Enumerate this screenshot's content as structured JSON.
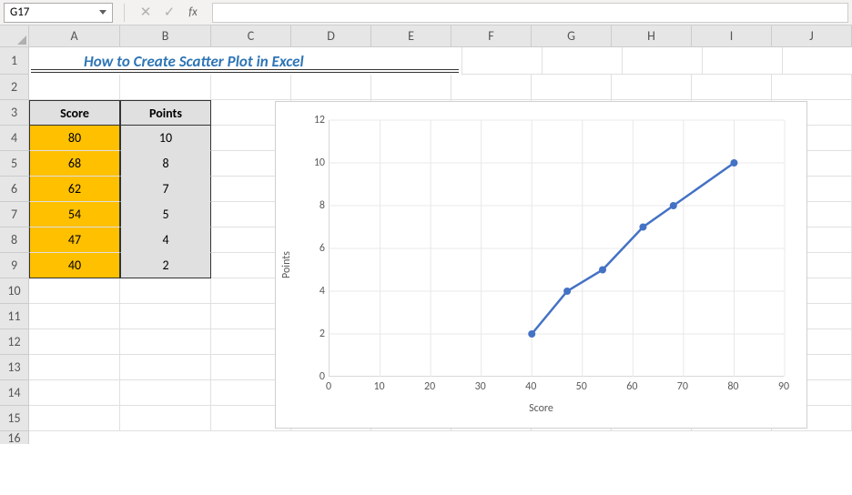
{
  "formula_bar": {
    "cell_ref": "G17",
    "cancel": "✕",
    "enter": "✓",
    "fx": "fx",
    "value": ""
  },
  "columns": [
    "A",
    "B",
    "C",
    "D",
    "E",
    "F",
    "G",
    "H",
    "I",
    "J"
  ],
  "rows": [
    "1",
    "2",
    "3",
    "4",
    "5",
    "6",
    "7",
    "8",
    "9",
    "10",
    "11",
    "12",
    "13",
    "14",
    "15",
    "16"
  ],
  "title": "How to Create Scatter Plot in Excel",
  "table": {
    "headers": {
      "score": "Score",
      "points": "Points"
    },
    "rows": [
      {
        "score": "80",
        "points": "10"
      },
      {
        "score": "68",
        "points": "8"
      },
      {
        "score": "62",
        "points": "7"
      },
      {
        "score": "54",
        "points": "5"
      },
      {
        "score": "47",
        "points": "4"
      },
      {
        "score": "40",
        "points": "2"
      }
    ]
  },
  "chart_data": {
    "type": "scatter",
    "title": "",
    "xlabel": "Score",
    "ylabel": "Points",
    "xlim": [
      0,
      90
    ],
    "ylim": [
      0,
      12
    ],
    "x_ticks": [
      0,
      10,
      20,
      30,
      40,
      50,
      60,
      70,
      80,
      90
    ],
    "y_ticks": [
      0,
      2,
      4,
      6,
      8,
      10,
      12
    ],
    "series": [
      {
        "name": "Points",
        "x": [
          40,
          47,
          54,
          62,
          68,
          80
        ],
        "y": [
          2,
          4,
          5,
          7,
          8,
          10
        ]
      }
    ]
  }
}
